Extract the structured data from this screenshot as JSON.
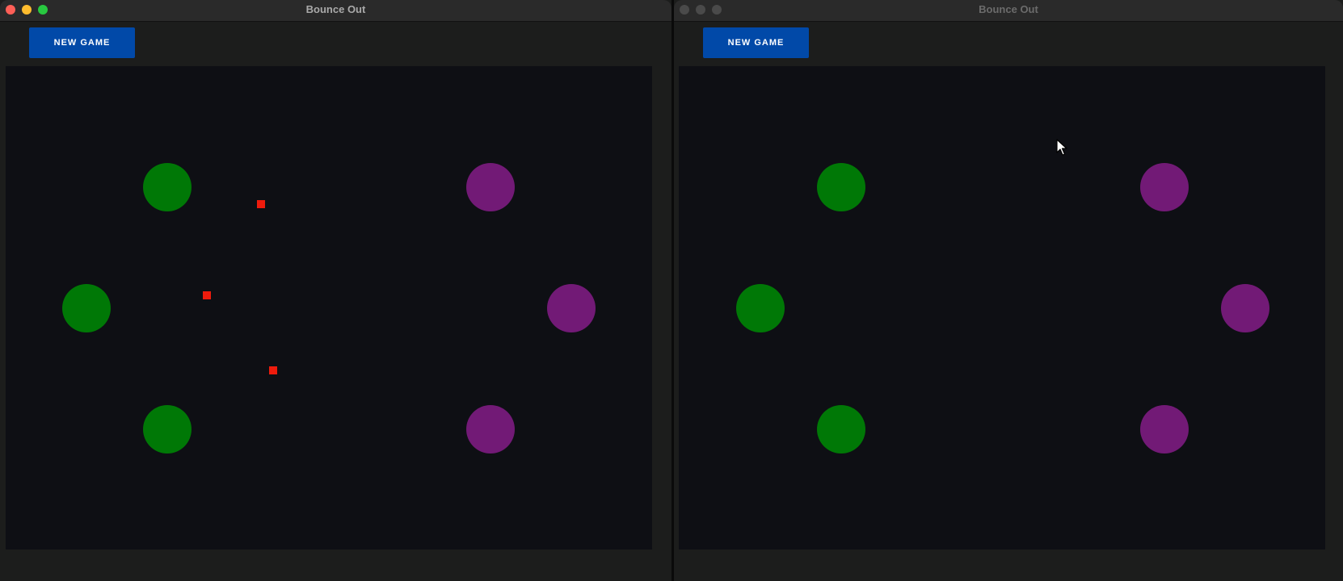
{
  "windows": [
    {
      "title": "Bounce Out",
      "new_game_label": "NEW GAME"
    },
    {
      "title": "Bounce Out",
      "new_game_label": "NEW GAME"
    }
  ],
  "colors": {
    "green_ball": "#007806",
    "purple_ball": "#721a76",
    "red_token": "#ee1b0c",
    "button": "#0149a8"
  }
}
